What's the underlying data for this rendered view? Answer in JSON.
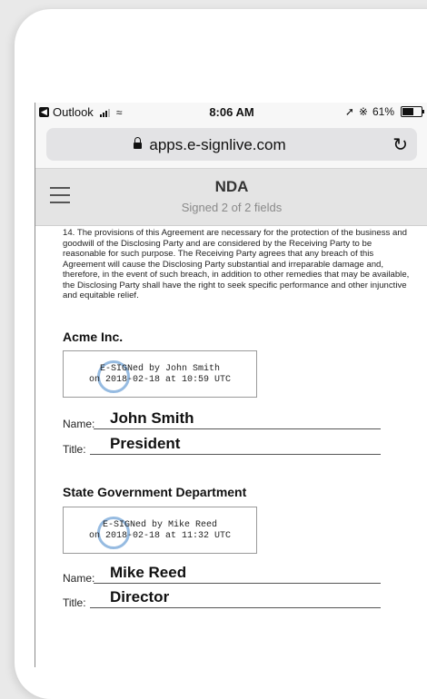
{
  "status_bar": {
    "back_app": "Outlook",
    "time": "8:06 AM",
    "battery": "61%",
    "battery_level": 0.61
  },
  "browser": {
    "url": "apps.e-signlive.com"
  },
  "header": {
    "title": "NDA",
    "subtitle": "Signed 2 of 2 fields"
  },
  "document": {
    "clause_text": "14.   The provisions of this Agreement are necessary for the protection of the business and goodwill of the Disclosing Party and are considered by the Receiving Party to be reasonable for such purpose. The Receiving Party agrees that any breach of this Agreement will cause the Disclosing Party substantial and irreparable damage and, therefore, in the event of such breach, in addition to other remedies that may be available, the Disclosing Party shall have the right to seek specific performance and other injunctive and equitable relief.",
    "parties": [
      {
        "name": "Acme Inc.",
        "stamp_line1": "E-SIGNed by John Smith",
        "stamp_line2": "on 2018-02-18 at 10:59 UTC",
        "name_label": "Name:",
        "name_value": "John Smith",
        "title_label": "Title:",
        "title_value": "President"
      },
      {
        "name": "State Government Department",
        "stamp_line1": "E-SIGNed by Mike Reed",
        "stamp_line2": "on 2018-02-18 at 11:32 UTC",
        "name_label": "Name:",
        "name_value": "Mike Reed",
        "title_label": "Title:",
        "title_value": "Director"
      }
    ]
  },
  "colors": {
    "seal": "#3f84c8",
    "header_bg": "#e4e4e4",
    "url_bar_bg": "#e3e3e5"
  }
}
